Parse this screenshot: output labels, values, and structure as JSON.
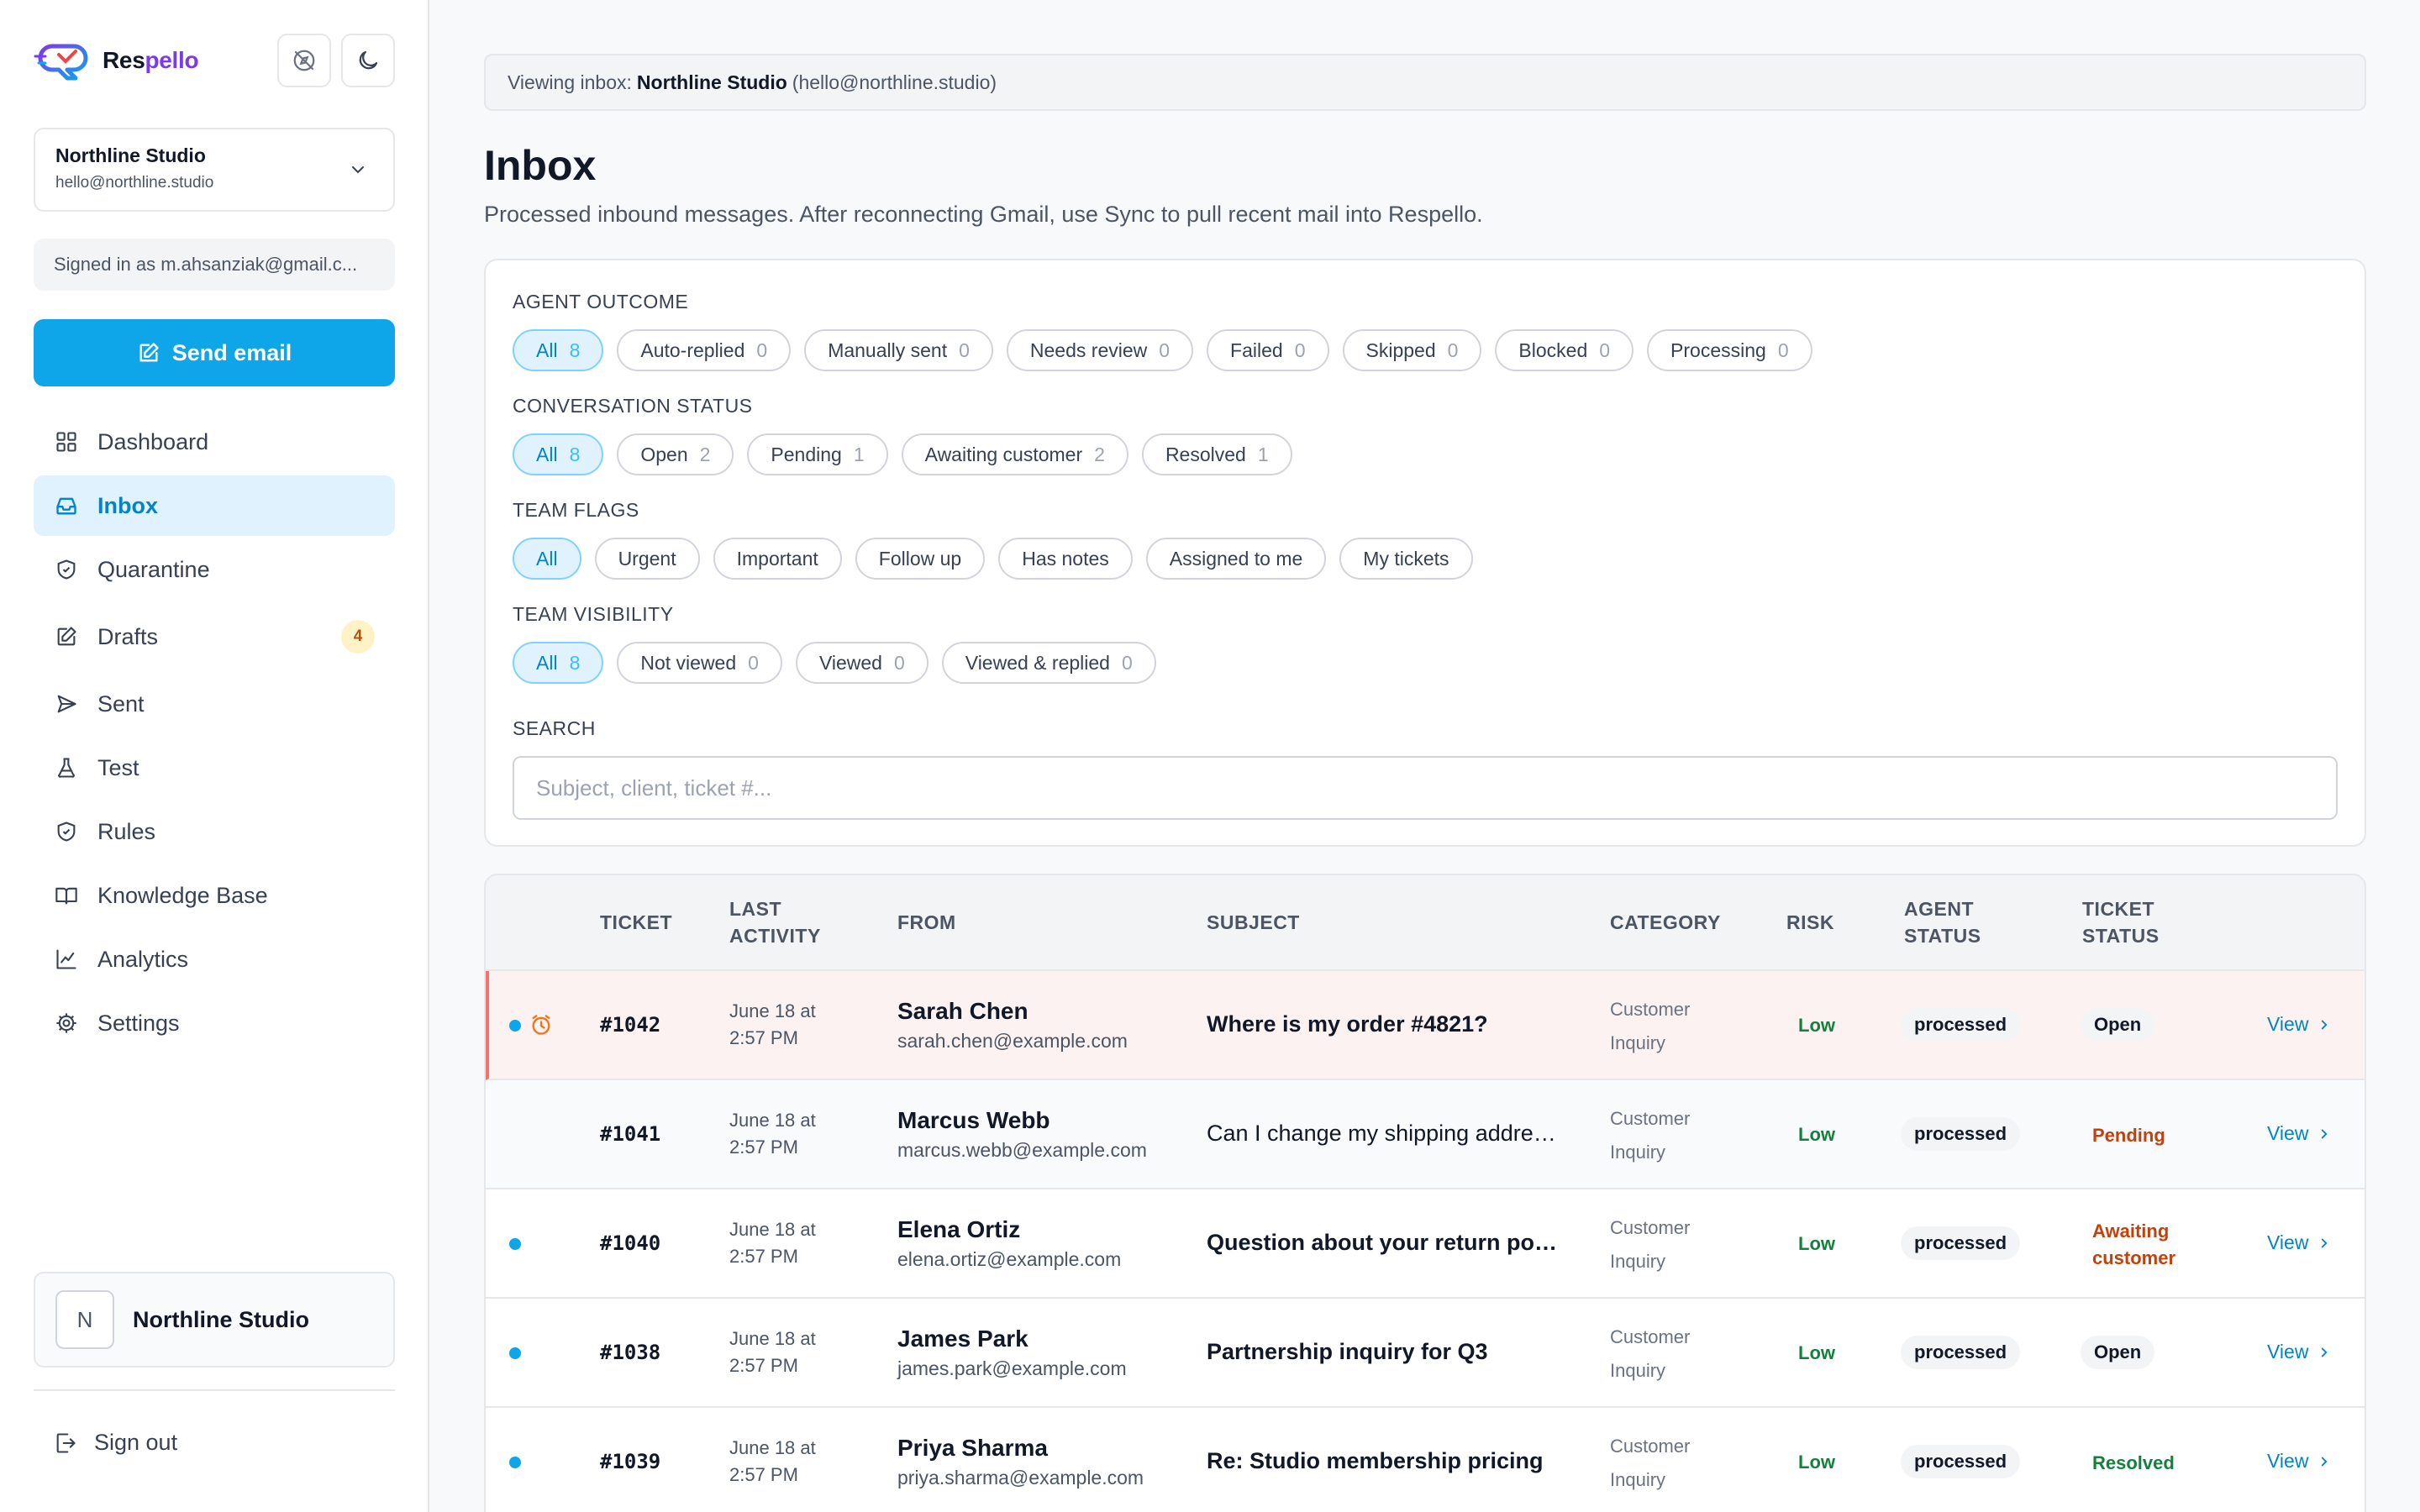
{
  "brand": {
    "name_start": "Res",
    "name_end": "pello"
  },
  "org_select": {
    "name": "Northline Studio",
    "email": "hello@northline.studio"
  },
  "signed_in": "Signed in as m.ahsanziak@gmail.c...",
  "send_button": "Send email",
  "nav": [
    {
      "label": "Dashboard",
      "icon": "grid-icon"
    },
    {
      "label": "Inbox",
      "icon": "inbox-icon",
      "active": true
    },
    {
      "label": "Quarantine",
      "icon": "shield-icon"
    },
    {
      "label": "Drafts",
      "icon": "edit-icon",
      "badge": "4"
    },
    {
      "label": "Sent",
      "icon": "send-icon"
    },
    {
      "label": "Test",
      "icon": "flask-icon"
    },
    {
      "label": "Rules",
      "icon": "shield-check-icon"
    },
    {
      "label": "Knowledge Base",
      "icon": "book-icon"
    },
    {
      "label": "Analytics",
      "icon": "chart-icon"
    },
    {
      "label": "Settings",
      "icon": "gear-icon"
    }
  ],
  "org_card": {
    "initial": "N",
    "name": "Northline Studio"
  },
  "sign_out": "Sign out",
  "viewing": {
    "prefix": "Viewing inbox:",
    "name": "Northline Studio",
    "email": "(hello@northline.studio)"
  },
  "page": {
    "title": "Inbox",
    "description": "Processed inbound messages. After reconnecting Gmail, use Sync to pull recent mail into Respello."
  },
  "filters": {
    "agent_outcome": {
      "label": "AGENT OUTCOME",
      "chips": [
        {
          "label": "All",
          "count": "8",
          "active": true
        },
        {
          "label": "Auto-replied",
          "count": "0"
        },
        {
          "label": "Manually sent",
          "count": "0"
        },
        {
          "label": "Needs review",
          "count": "0"
        },
        {
          "label": "Failed",
          "count": "0"
        },
        {
          "label": "Skipped",
          "count": "0"
        },
        {
          "label": "Blocked",
          "count": "0"
        },
        {
          "label": "Processing",
          "count": "0"
        }
      ]
    },
    "conversation_status": {
      "label": "CONVERSATION STATUS",
      "chips": [
        {
          "label": "All",
          "count": "8",
          "active": true
        },
        {
          "label": "Open",
          "count": "2"
        },
        {
          "label": "Pending",
          "count": "1"
        },
        {
          "label": "Awaiting customer",
          "count": "2"
        },
        {
          "label": "Resolved",
          "count": "1"
        }
      ]
    },
    "team_flags": {
      "label": "TEAM FLAGS",
      "chips": [
        {
          "label": "All",
          "active": true
        },
        {
          "label": "Urgent"
        },
        {
          "label": "Important"
        },
        {
          "label": "Follow up"
        },
        {
          "label": "Has notes"
        },
        {
          "label": "Assigned to me"
        },
        {
          "label": "My tickets"
        }
      ]
    },
    "team_visibility": {
      "label": "TEAM VISIBILITY",
      "chips": [
        {
          "label": "All",
          "count": "8",
          "active": true
        },
        {
          "label": "Not viewed",
          "count": "0"
        },
        {
          "label": "Viewed",
          "count": "0"
        },
        {
          "label": "Viewed & replied",
          "count": "0"
        }
      ]
    },
    "search": {
      "label": "SEARCH",
      "placeholder": "Subject, client, ticket #..."
    }
  },
  "table": {
    "headers": {
      "ticket": "TICKET",
      "last_activity": [
        "LAST",
        "ACTIVITY"
      ],
      "from": "FROM",
      "subject": "SUBJECT",
      "category": "CATEGORY",
      "risk": "RISK",
      "agent_status": [
        "AGENT",
        "STATUS"
      ],
      "ticket_status": [
        "TICKET",
        "STATUS"
      ]
    },
    "rows": [
      {
        "unread": true,
        "urgent": true,
        "highlight": true,
        "ticket": "#1042",
        "activity": [
          "June 18 at",
          "2:57 PM"
        ],
        "from_name": "Sarah Chen",
        "from_email": "sarah.chen@example.com",
        "subject": "Where is my order #4821?",
        "subject_bold": true,
        "category": [
          "Customer",
          "Inquiry"
        ],
        "risk": "Low",
        "agent_status": "processed",
        "ticket_status": [
          "Open"
        ],
        "status_color": "#111827",
        "status_pill": true,
        "view": "View"
      },
      {
        "unread": false,
        "gray": true,
        "ticket": "#1041",
        "activity": [
          "June 18 at",
          "2:57 PM"
        ],
        "from_name": "Marcus Webb",
        "from_email": "marcus.webb@example.com",
        "subject": "Can I change my shipping address?",
        "subject_bold": false,
        "category": [
          "Customer",
          "Inquiry"
        ],
        "risk": "Low",
        "agent_status": "processed",
        "ticket_status": [
          "Pending"
        ],
        "status_color": "#c2410c",
        "status_pill": false,
        "view": "View"
      },
      {
        "unread": true,
        "ticket": "#1040",
        "activity": [
          "June 18 at",
          "2:57 PM"
        ],
        "from_name": "Elena Ortiz",
        "from_email": "elena.ortiz@example.com",
        "subject": "Question about your return policy",
        "subject_bold": true,
        "category": [
          "Customer",
          "Inquiry"
        ],
        "risk": "Low",
        "agent_status": "processed",
        "ticket_status": [
          "Awaiting",
          "customer"
        ],
        "status_color": "#c2410c",
        "status_pill": false,
        "view": "View"
      },
      {
        "unread": true,
        "ticket": "#1038",
        "activity": [
          "June 18 at",
          "2:57 PM"
        ],
        "from_name": "James Park",
        "from_email": "james.park@example.com",
        "subject": "Partnership inquiry for Q3",
        "subject_bold": true,
        "category": [
          "Customer",
          "Inquiry"
        ],
        "risk": "Low",
        "agent_status": "processed",
        "ticket_status": [
          "Open"
        ],
        "status_color": "#111827",
        "status_pill": true,
        "view": "View"
      },
      {
        "unread": true,
        "ticket": "#1039",
        "activity": [
          "June 18 at",
          "2:57 PM"
        ],
        "from_name": "Priya Sharma",
        "from_email": "priya.sharma@example.com",
        "subject": "Re: Studio membership pricing",
        "subject_bold": true,
        "category": [
          "Customer",
          "Inquiry"
        ],
        "risk": "Low",
        "agent_status": "processed",
        "ticket_status": [
          "Resolved"
        ],
        "status_color": "#15803d",
        "status_pill": false,
        "view": "View"
      }
    ]
  }
}
